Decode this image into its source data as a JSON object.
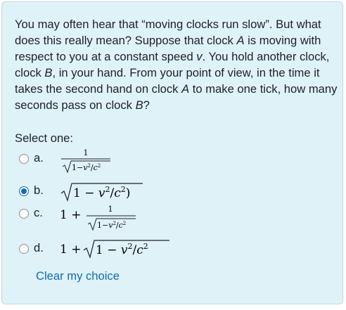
{
  "question": {
    "segments": [
      {
        "t": "You may often hear that “moving clocks run slow”. But what does this really mean? Suppose that clock "
      },
      {
        "t": "A",
        "i": true
      },
      {
        "t": " is moving with respect to you at a constant speed "
      },
      {
        "t": "v",
        "i": true
      },
      {
        "t": ". You hold another clock, clock "
      },
      {
        "t": "B",
        "i": true
      },
      {
        "t": ", in your hand. From your point of view, in the time it takes the second hand on clock "
      },
      {
        "t": "A",
        "i": true
      },
      {
        "t": " to make one tick, how many seconds pass on clock "
      },
      {
        "t": "B",
        "i": true
      },
      {
        "t": "?"
      }
    ]
  },
  "prompt": "Select one:",
  "options": [
    {
      "letter": "a.",
      "formula": "1/√(1−v²/c²)",
      "selected": false
    },
    {
      "letter": "b.",
      "formula": "√(1 − v²/c²)",
      "selected": true
    },
    {
      "letter": "c.",
      "formula": "1 + 1/√(1−v²/c²)",
      "selected": false
    },
    {
      "letter": "d.",
      "formula": "1 + √(1 − v²/c²)",
      "selected": false
    }
  ],
  "clear_label": "Clear my choice",
  "colors": {
    "accent": "#0f6cbf",
    "card_bg": "#def2f8",
    "card_border": "#b8dce7"
  }
}
